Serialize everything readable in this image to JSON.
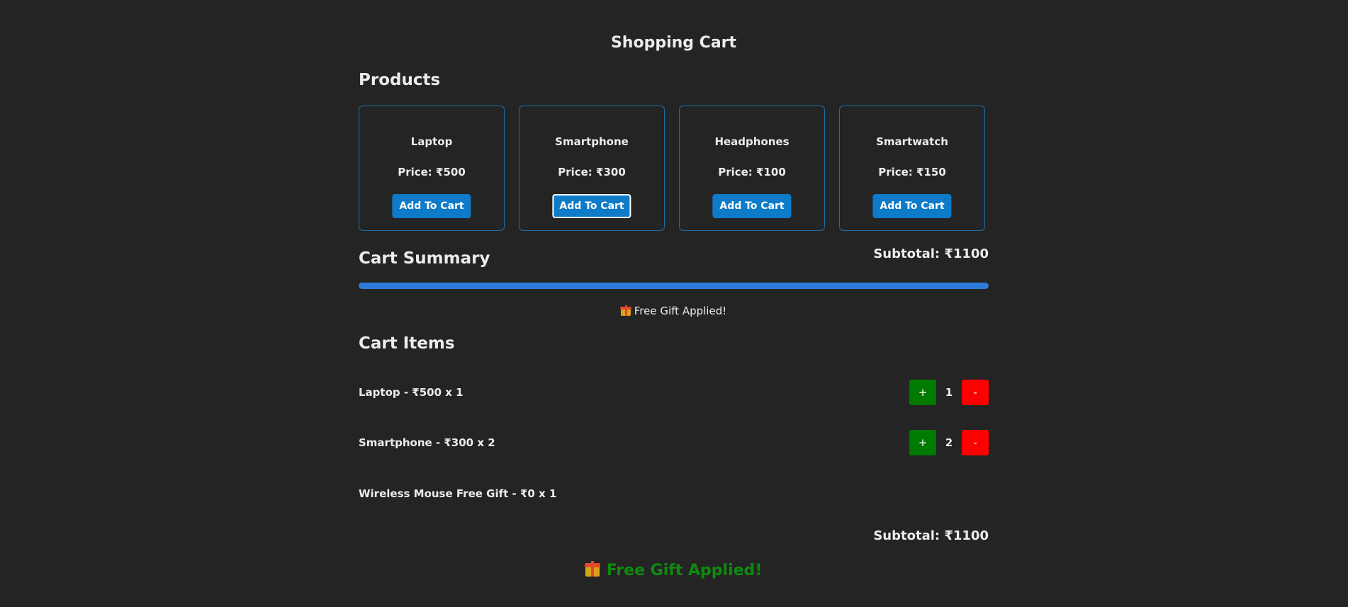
{
  "page": {
    "title": "Shopping Cart"
  },
  "products_section": {
    "heading": "Products",
    "items": [
      {
        "name": "Laptop",
        "price_label": "Price: ₹500",
        "button_label": "Add To Cart"
      },
      {
        "name": "Smartphone",
        "price_label": "Price: ₹300",
        "button_label": "Add To Cart"
      },
      {
        "name": "Headphones",
        "price_label": "Price: ₹100",
        "button_label": "Add To Cart"
      },
      {
        "name": "Smartwatch",
        "price_label": "Price: ₹150",
        "button_label": "Add To Cart"
      }
    ]
  },
  "cart_summary": {
    "heading": "Cart Summary",
    "subtotal_label": "Subtotal: ₹1100",
    "progress_fraction": 1.0,
    "gift_note": "Free Gift Applied!"
  },
  "cart_items_section": {
    "heading": "Cart Items",
    "items": [
      {
        "label": "Laptop - ₹500 x 1",
        "quantity": "1",
        "plus_label": "+",
        "minus_label": "-"
      },
      {
        "label": "Smartphone - ₹300 x 2",
        "quantity": "2",
        "plus_label": "+",
        "minus_label": "-"
      },
      {
        "label": "Wireless Mouse Free Gift - ₹0 x 1"
      }
    ],
    "subtotal_label": "Subtotal: ₹1100",
    "gift_banner": "Free Gift Applied!"
  },
  "colors": {
    "background": "#242424",
    "card_border": "#1a6fa6",
    "button_blue": "#0e7bc8",
    "progress_blue": "#2f7bdc",
    "plus_green": "#007a00",
    "minus_red": "#ff0000",
    "gift_green": "#0e8a0e"
  },
  "icons": {
    "gift": "gift-icon"
  }
}
